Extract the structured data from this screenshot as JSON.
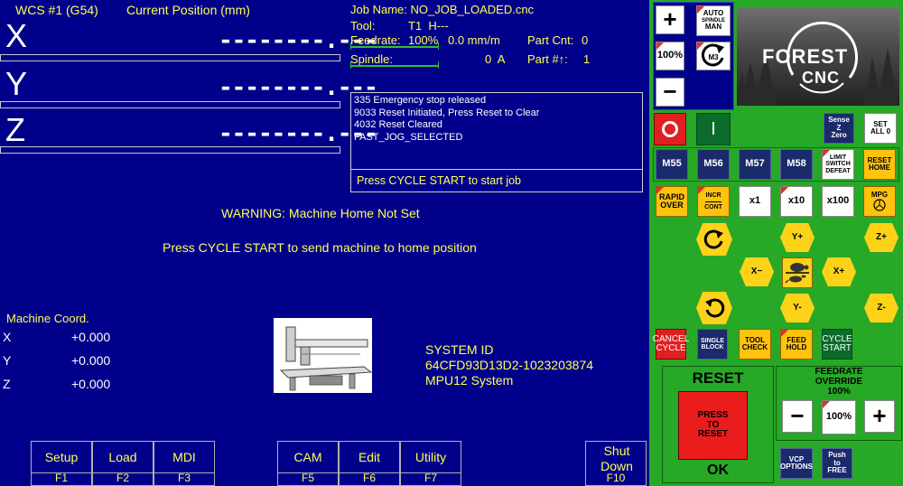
{
  "dro": {
    "wcs": "WCS #1 (G54)",
    "position_label": "Current Position (mm)",
    "axes": [
      {
        "letter": "X",
        "value": "--------.---"
      },
      {
        "letter": "Y",
        "value": "--------.---"
      },
      {
        "letter": "Z",
        "value": "--------.---"
      }
    ]
  },
  "job": {
    "name_label": "Job Name:",
    "name": "NO_JOB_LOADED.cnc",
    "tool_label": "Tool:",
    "tool": "T1  H---",
    "feedrate_label": "Feedrate:",
    "feedrate_pct": "100%",
    "feedrate_val": "0.0 mm/m",
    "part_cnt_label": "Part Cnt:",
    "part_cnt": "0",
    "spindle_label": "Spindle:",
    "spindle_val": "0  A",
    "part_num_label": "Part #↑:",
    "part_num": "1"
  },
  "messages": {
    "lines": [
      "335 Emergency stop released",
      "9033 Reset Initiated, Press Reset to Clear",
      "4032 Reset Cleared",
      "FAST_JOG_SELECTED"
    ],
    "prompt": "Press CYCLE START to start job"
  },
  "warning": "WARNING: Machine Home Not Set",
  "home_prompt": "Press CYCLE START to send machine to home position",
  "machine_coord": {
    "title": "Machine Coord.",
    "rows": [
      {
        "axis": "X",
        "value": "+0.000"
      },
      {
        "axis": "Y",
        "value": "+0.000"
      },
      {
        "axis": "Z",
        "value": "+0.000"
      }
    ]
  },
  "system": {
    "label": "SYSTEM ID",
    "id": "64CFD93D13D2-1023203874",
    "model": "MPU12 System"
  },
  "fkeys": [
    {
      "label": "Setup",
      "fn": "F1"
    },
    {
      "label": "Load",
      "fn": "F2"
    },
    {
      "label": "MDI",
      "fn": "F3"
    },
    {
      "label": "CAM",
      "fn": "F5"
    },
    {
      "label": "Edit",
      "fn": "F6"
    },
    {
      "label": "Utility",
      "fn": "F7"
    },
    {
      "label": "Shut Down",
      "fn": "F10"
    }
  ],
  "vcp": {
    "plus": "+",
    "minus": "−",
    "auto_spindle": [
      "AUTO",
      "SPINDLE",
      "MAN"
    ],
    "spindle_pct": "100%",
    "m3": "M3",
    "power_on": "I",
    "logo": [
      "FOREST",
      "CNC"
    ],
    "sense_z": [
      "Sense",
      "Z",
      "Zero"
    ],
    "set_all": [
      "SET",
      "ALL 0"
    ],
    "m_codes": [
      "M55",
      "M56",
      "M57",
      "M58"
    ],
    "limit_defeat": [
      "LIMIT",
      "SWITCH",
      "DEFEAT"
    ],
    "reset_home": [
      "RESET",
      "HOME"
    ],
    "rapid_over": [
      "RAPID",
      "OVER"
    ],
    "incr_cont": [
      "INCR",
      "CONT"
    ],
    "x1": "x1",
    "x10": "x10",
    "x100": "x100",
    "mpg": "MPG",
    "y_plus": "Y+",
    "z_plus": "Z+",
    "x_minus": "X−",
    "x_plus": "X+",
    "y_minus": "Y-",
    "z_minus": "Z-",
    "cancel_cycle": [
      "CANCEL",
      "CYCLE"
    ],
    "single_block": [
      "SINGLE",
      "BLOCK"
    ],
    "tool_check": [
      "TOOL",
      "CHECK"
    ],
    "feed_hold": [
      "FEED",
      "HOLD"
    ],
    "cycle_start": [
      "CYCLE",
      "START"
    ],
    "reset_title": "RESET",
    "press_reset": [
      "PRESS",
      "TO",
      "RESET"
    ],
    "reset_status": "OK",
    "feed_override_title": [
      "FEEDRATE",
      "OVERRIDE"
    ],
    "feed_override_pct": "100%",
    "feed_override_value": "100%",
    "vcp_options": [
      "VCP",
      "OPTIONS"
    ],
    "push_free": [
      "Push",
      "to",
      "FREE"
    ]
  }
}
